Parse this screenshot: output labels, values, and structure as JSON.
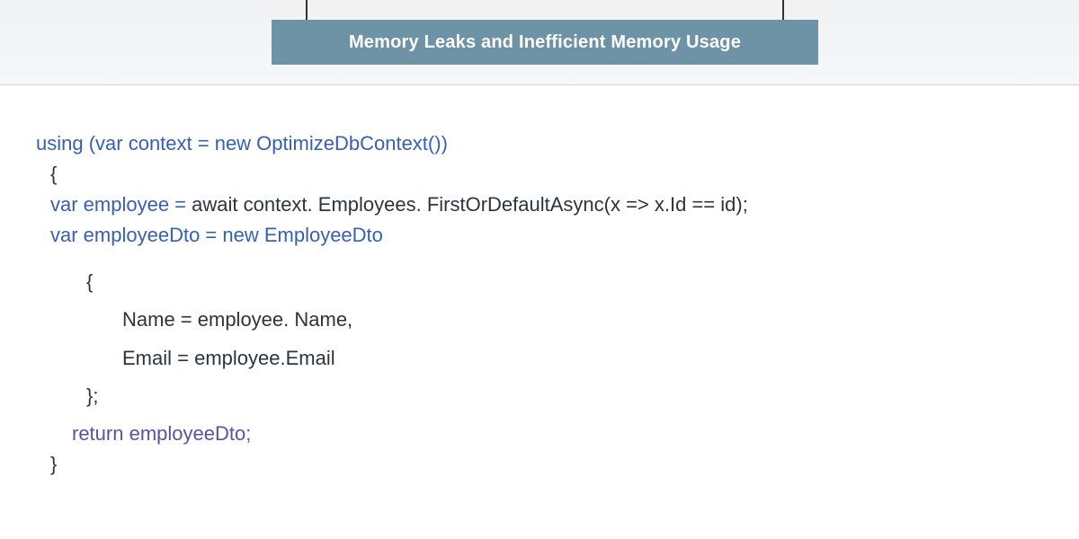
{
  "header": {
    "title": "Memory Leaks and Inefficient Memory Usage"
  },
  "code": {
    "l1": "using (var context = new OptimizeDbContext())",
    "l2": "{",
    "l3_a": "var employee = ",
    "l3_b": "await context. Employees. FirstOrDefaultAsync(x => x.Id == id);",
    "l4": "var employeeDto = new EmployeeDto",
    "l5": "{",
    "l6": "Name = employee. Name,",
    "l7": "Email = employee.Email",
    "l8": "};",
    "l9_a": "return",
    "l9_b": " employeeDto;",
    "l10": "}"
  }
}
